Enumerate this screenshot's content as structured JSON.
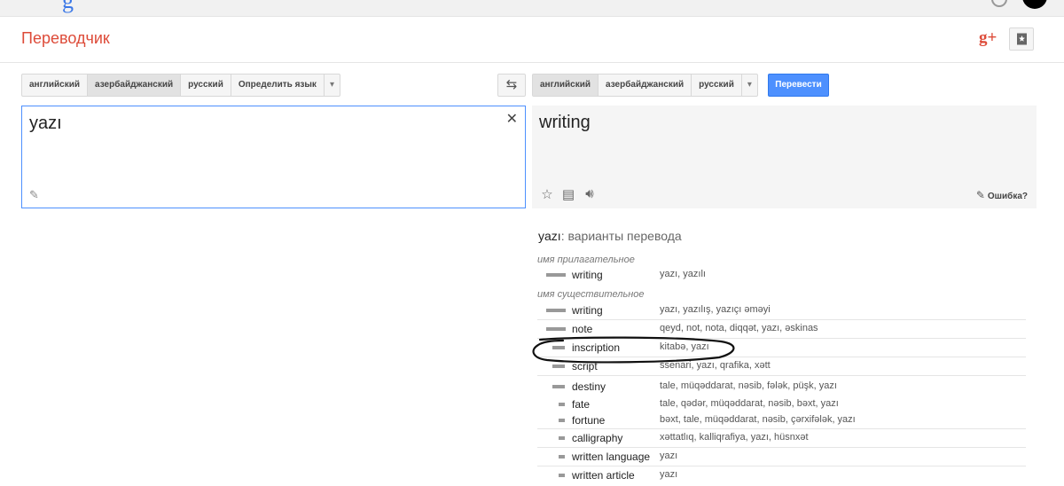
{
  "app": {
    "title": "Переводчик"
  },
  "source_langs": [
    "английский",
    "азербайджанский",
    "русский",
    "Определить язык"
  ],
  "source_active": 1,
  "target_langs": [
    "английский",
    "азербайджанский",
    "русский"
  ],
  "target_active": 0,
  "translate_button": "Перевести",
  "swap_icon": "⇆",
  "source_text": "yazı",
  "result_text": "writing",
  "report_label": "Ошибка?",
  "dictionary": {
    "word": "yazı",
    "title_suffix": ": варианты перевода",
    "groups": [
      {
        "pos": "имя прилагательное",
        "entries": [
          {
            "word": "writing",
            "translations": "yazı, yazılı",
            "freq": 3
          }
        ]
      },
      {
        "pos": "имя существительное",
        "entries": [
          {
            "word": "writing",
            "translations": "yazı, yazılış, yazıçı əməyi",
            "freq": 3
          },
          {
            "word": "note",
            "translations": "qeyd, not, nota, diqqət, yazı, əskinas",
            "freq": 3
          },
          {
            "word": "inscription",
            "translations": "kitabə, yazı",
            "freq": 2
          },
          {
            "word": "script",
            "translations": "ssenari, yazı, qrafika, xətt",
            "freq": 2
          },
          {
            "word": "destiny",
            "translations": "tale, müqəddarat, nəsib, fələk, püşk, yazı",
            "freq": 2
          },
          {
            "word": "fate",
            "translations": "tale, qədər, müqəddarat, nəsib, bəxt, yazı",
            "freq": 1
          },
          {
            "word": "fortune",
            "translations": "bəxt, tale, müqəddarat, nəsib, çərxifələk, yazı",
            "freq": 1
          },
          {
            "word": "calligraphy",
            "translations": "xəttatlıq, kalliqrafiya, yazı, hüsnxət",
            "freq": 1
          },
          {
            "word": "written language",
            "translations": "yazı",
            "freq": 1
          },
          {
            "word": "written article",
            "translations": "yazı",
            "freq": 1
          }
        ]
      }
    ]
  }
}
